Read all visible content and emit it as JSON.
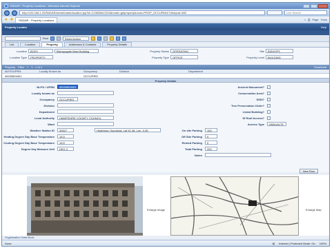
{
  "window": {
    "title": "RADAR - Property Locations - Windows Internet Explorer"
  },
  "addressbar": {
    "url": "http://192.168.1.20/RADAR/servlet/radar/location.jsp?id=CONDBACK33&mode=getproperty&rows=PROP_OCCUPANCY&keyval=602",
    "search_placeholder": "Live Search"
  },
  "favbar": {
    "tab_label": "RADAR - Property Locations",
    "page_menu": "Page",
    "tools_menu": "Tools"
  },
  "app": {
    "name": "Property Locator",
    "help": "Help"
  },
  "toolbar": {
    "find_label": "Find",
    "action_select": "Select Action"
  },
  "tabs": [
    "List",
    "Location",
    "Property",
    "Addresses & Contacts",
    "Property Details"
  ],
  "active_tab": 2,
  "topform": {
    "location_label": "Location",
    "location_value": "BODY",
    "location_name": "Bishopsgate Main Building",
    "location_type_label": "Location Type",
    "location_type_value": "PROPERTY",
    "property_status_label": "Property Status",
    "property_status_value": "OPERATING",
    "property_type_label": "Property Type",
    "property_type_value": "OFFICE",
    "site_label": "Site",
    "site_value": "BISHOPS",
    "property_level_label": "Property Level",
    "property_level_value": "BUILDING"
  },
  "grid": {
    "title": "Property",
    "filter_label": "Filter",
    "pager": "1 - 1 of 1",
    "download": "Download",
    "columns": [
      "NLPG/UPRN",
      "Locally Known as",
      "Occupancy",
      "Division",
      "Department"
    ],
    "row": [
      "46230804401",
      "",
      "OCCUPIED",
      "",
      ""
    ]
  },
  "details": {
    "section_title": "Property Details",
    "nlpg_label": "NLPG / UPRN",
    "nlpg_value": "46230804401",
    "locally_known_label": "Locally known as",
    "occupancy_label": "Occupancy",
    "occupancy_value": "OCCUPIED",
    "division_label": "Division",
    "department_label": "Department",
    "local_authority_label": "Local Authority",
    "local_authority_value": "HAMPSHIRE COUNTY COUNCIL",
    "ward_label": "Ward",
    "weather_station_label": "Weather Station ID",
    "weather_station_value": "30527",
    "weather_station_name": "Heathrow, Hounslow, Lat 51.48, Lon -0.45",
    "heating_label": "Heating Degree Day Base Temperature",
    "heating_value": "15.5",
    "cooling_label": "Cooling Degree Day Base Temperature",
    "cooling_value": "15.5",
    "dd_unit_label": "Degree Day Measure Unit",
    "dd_unit_value": "DEG C",
    "ancient_monument_label": "Ancient Monument?",
    "conservation_label": "Conservation Area?",
    "sssi_label": "SSSI?",
    "tree_label": "Tree Preservation Order?",
    "listed_label": "Listed Building?",
    "roof_label": "Sf Roof Access?",
    "access_type_label": "Access Type",
    "access_type_value": "ANNUALTE",
    "onsite_parking_label": "On site Parking",
    "onsite_parking_value": "100",
    "offsite_parking_label": "Off Site Parking",
    "offsite_parking_value": "0",
    "renting_parking_label": "Rented Parking",
    "renting_parking_value": "0",
    "total_parking_label": "Total Parking",
    "total_parking_value": "200",
    "notes_label": "Notes"
  },
  "images": {
    "new_row_label": "New Row",
    "enlarge_image": "Enlarge Image",
    "enlarge_map": "Enlarge Map"
  },
  "orgbar": {
    "label": "Organisation Data Book"
  },
  "statusbar": {
    "left": "Done",
    "zone": "Internet | Protected Mode: On",
    "zoom": "100%"
  }
}
